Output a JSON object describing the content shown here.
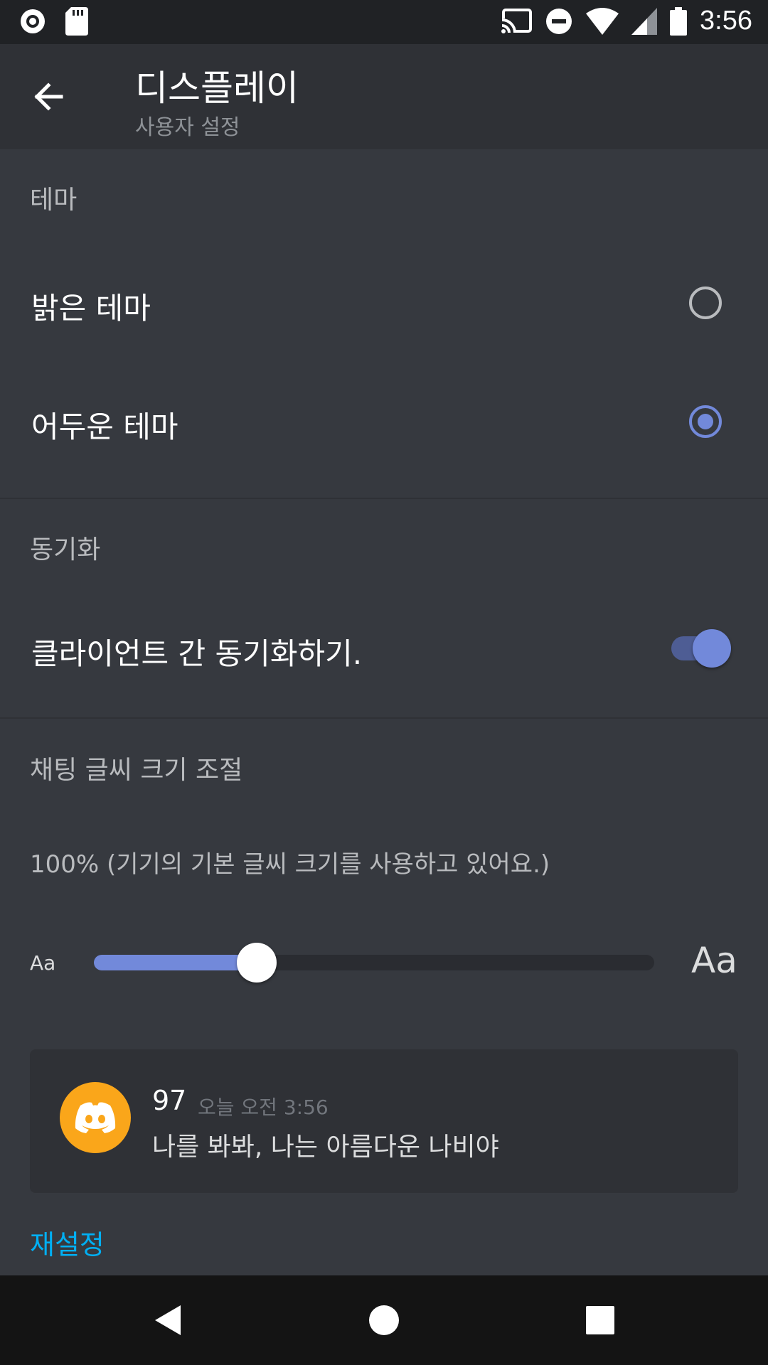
{
  "status_bar": {
    "time": "3:56",
    "left_icons": [
      "record-icon",
      "sd-card-icon"
    ],
    "right_icons": [
      "cast-icon",
      "do-not-disturb-icon",
      "wifi-icon",
      "signal-icon",
      "battery-icon"
    ]
  },
  "app_bar": {
    "title": "디스플레이",
    "subtitle": "사용자 설정",
    "back_icon": "arrow-left-icon"
  },
  "theme_section": {
    "header": "테마",
    "options": [
      {
        "label": "밝은 테마",
        "selected": false
      },
      {
        "label": "어두운 테마",
        "selected": true
      }
    ]
  },
  "sync_section": {
    "header": "동기화",
    "toggle_label": "클라이언트 간 동기화하기.",
    "toggle_on": true
  },
  "font_section": {
    "header": "채팅 글씨 크기 조절",
    "description": "100% (기기의 기본 글씨 크기를 사용하고 있어요.)",
    "small_label": "Aa",
    "large_label": "Aa",
    "slider_value_fraction": 0.29
  },
  "preview": {
    "username": "97",
    "timestamp": "오늘 오전 3:56",
    "message": "나를 봐봐, 나는 아름다운 나비야",
    "avatar_icon": "discord-logo-icon"
  },
  "reset_label": "재설정",
  "nav_bar": {
    "icons": [
      "back-triangle-icon",
      "home-circle-icon",
      "recents-square-icon"
    ]
  },
  "colors": {
    "background": "#36393f",
    "app_bar": "#2f3136",
    "accent": "#7289da",
    "link": "#00b0f4",
    "avatar": "#faa61a"
  }
}
